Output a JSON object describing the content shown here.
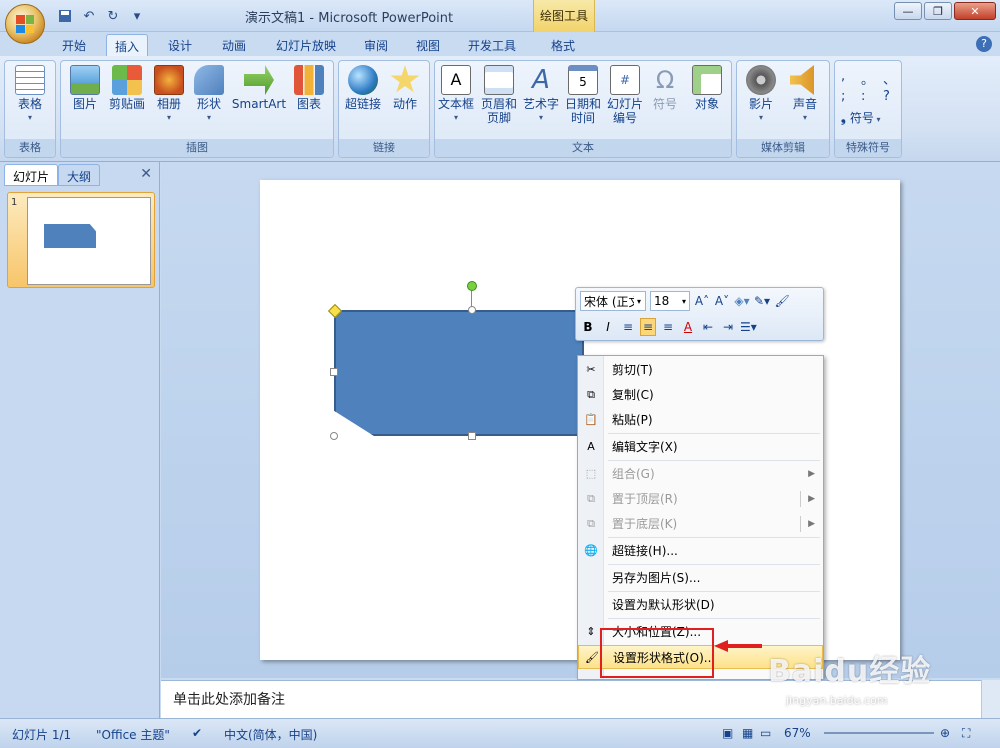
{
  "window": {
    "title": "演示文稿1 - Microsoft PowerPoint",
    "tool_tab": "绘图工具"
  },
  "qat": {
    "save": "save-icon",
    "undo": "↶",
    "redo": "↻",
    "customize": "▾"
  },
  "tabs": [
    "开始",
    "插入",
    "设计",
    "动画",
    "幻灯片放映",
    "审阅",
    "视图",
    "开发工具",
    "格式"
  ],
  "active_tab": "插入",
  "ribbon": {
    "groups": [
      "表格",
      "插图",
      "链接",
      "文本",
      "媒体剪辑",
      "特殊符号"
    ],
    "buttons": {
      "table": "表格",
      "picture": "图片",
      "clipart": "剪贴画",
      "album": "相册",
      "shapes": "形状",
      "smartart": "SmartArt",
      "chart": "图表",
      "hyperlink": "超链接",
      "action": "动作",
      "textbox": "文本框",
      "header1": "页眉和",
      "header2": "页脚",
      "wordart": "艺术字",
      "datetime1": "日期和",
      "datetime2": "时间",
      "slidenum1": "幻灯片",
      "slidenum2": "编号",
      "symbol": "符号",
      "object": "对象",
      "movie": "影片",
      "sound": "声音",
      "special_symbol": "符号"
    },
    "symbols": [
      ",",
      "。",
      "、",
      ";",
      ":",
      "?"
    ]
  },
  "left_pane": {
    "tab_slides": "幻灯片",
    "tab_outline": "大纲",
    "close": "✕",
    "slide_number": "1"
  },
  "mini_toolbar": {
    "font": "宋体 (正文",
    "size": "18",
    "grow": "A˄",
    "shrink": "A˅",
    "bold": "B",
    "italic": "I",
    "font_color": "A"
  },
  "context_menu": [
    {
      "label": "剪切(T)",
      "icon": "scissors-icon",
      "glyph": "✂",
      "disabled": false
    },
    {
      "label": "复制(C)",
      "icon": "copy-icon",
      "glyph": "⧉",
      "disabled": false
    },
    {
      "label": "粘贴(P)",
      "icon": "paste-icon",
      "glyph": "📋",
      "disabled": false
    },
    {
      "label": "编辑文字(X)",
      "icon": "edit-text-icon",
      "glyph": "A",
      "disabled": false
    },
    {
      "label": "组合(G)",
      "icon": "group-icon",
      "glyph": "⬚",
      "disabled": true
    },
    {
      "label": "置于顶层(R)",
      "icon": "bring-front-icon",
      "glyph": "⧉",
      "disabled": true
    },
    {
      "label": "置于底层(K)",
      "icon": "send-back-icon",
      "glyph": "⧉",
      "disabled": true
    },
    {
      "label": "超链接(H)...",
      "icon": "hyperlink-icon",
      "glyph": "🌐",
      "disabled": false
    },
    {
      "label": "另存为图片(S)...",
      "icon": "",
      "glyph": "",
      "disabled": false
    },
    {
      "label": "设置为默认形状(D)",
      "icon": "",
      "glyph": "",
      "disabled": false
    },
    {
      "label": "大小和位置(Z)...",
      "icon": "size-position-icon",
      "glyph": "⇕",
      "disabled": false
    },
    {
      "label": "设置形状格式(O)...",
      "icon": "format-shape-icon",
      "glyph": "🖌",
      "disabled": false
    }
  ],
  "notes_placeholder": "单击此处添加备注",
  "status": {
    "slide": "幻灯片 1/1",
    "theme": "\"Office 主题\"",
    "lang": "中文(简体，中国)",
    "zoom": "67%"
  },
  "watermark": {
    "logo": "Baidu经验",
    "url": "jingyan.baidu.com"
  },
  "colors": {
    "shape_fill": "#4f81bd",
    "shape_border": "#385d8a",
    "highlight_box": "#e02020",
    "accent_tab": "#f1d36a"
  }
}
